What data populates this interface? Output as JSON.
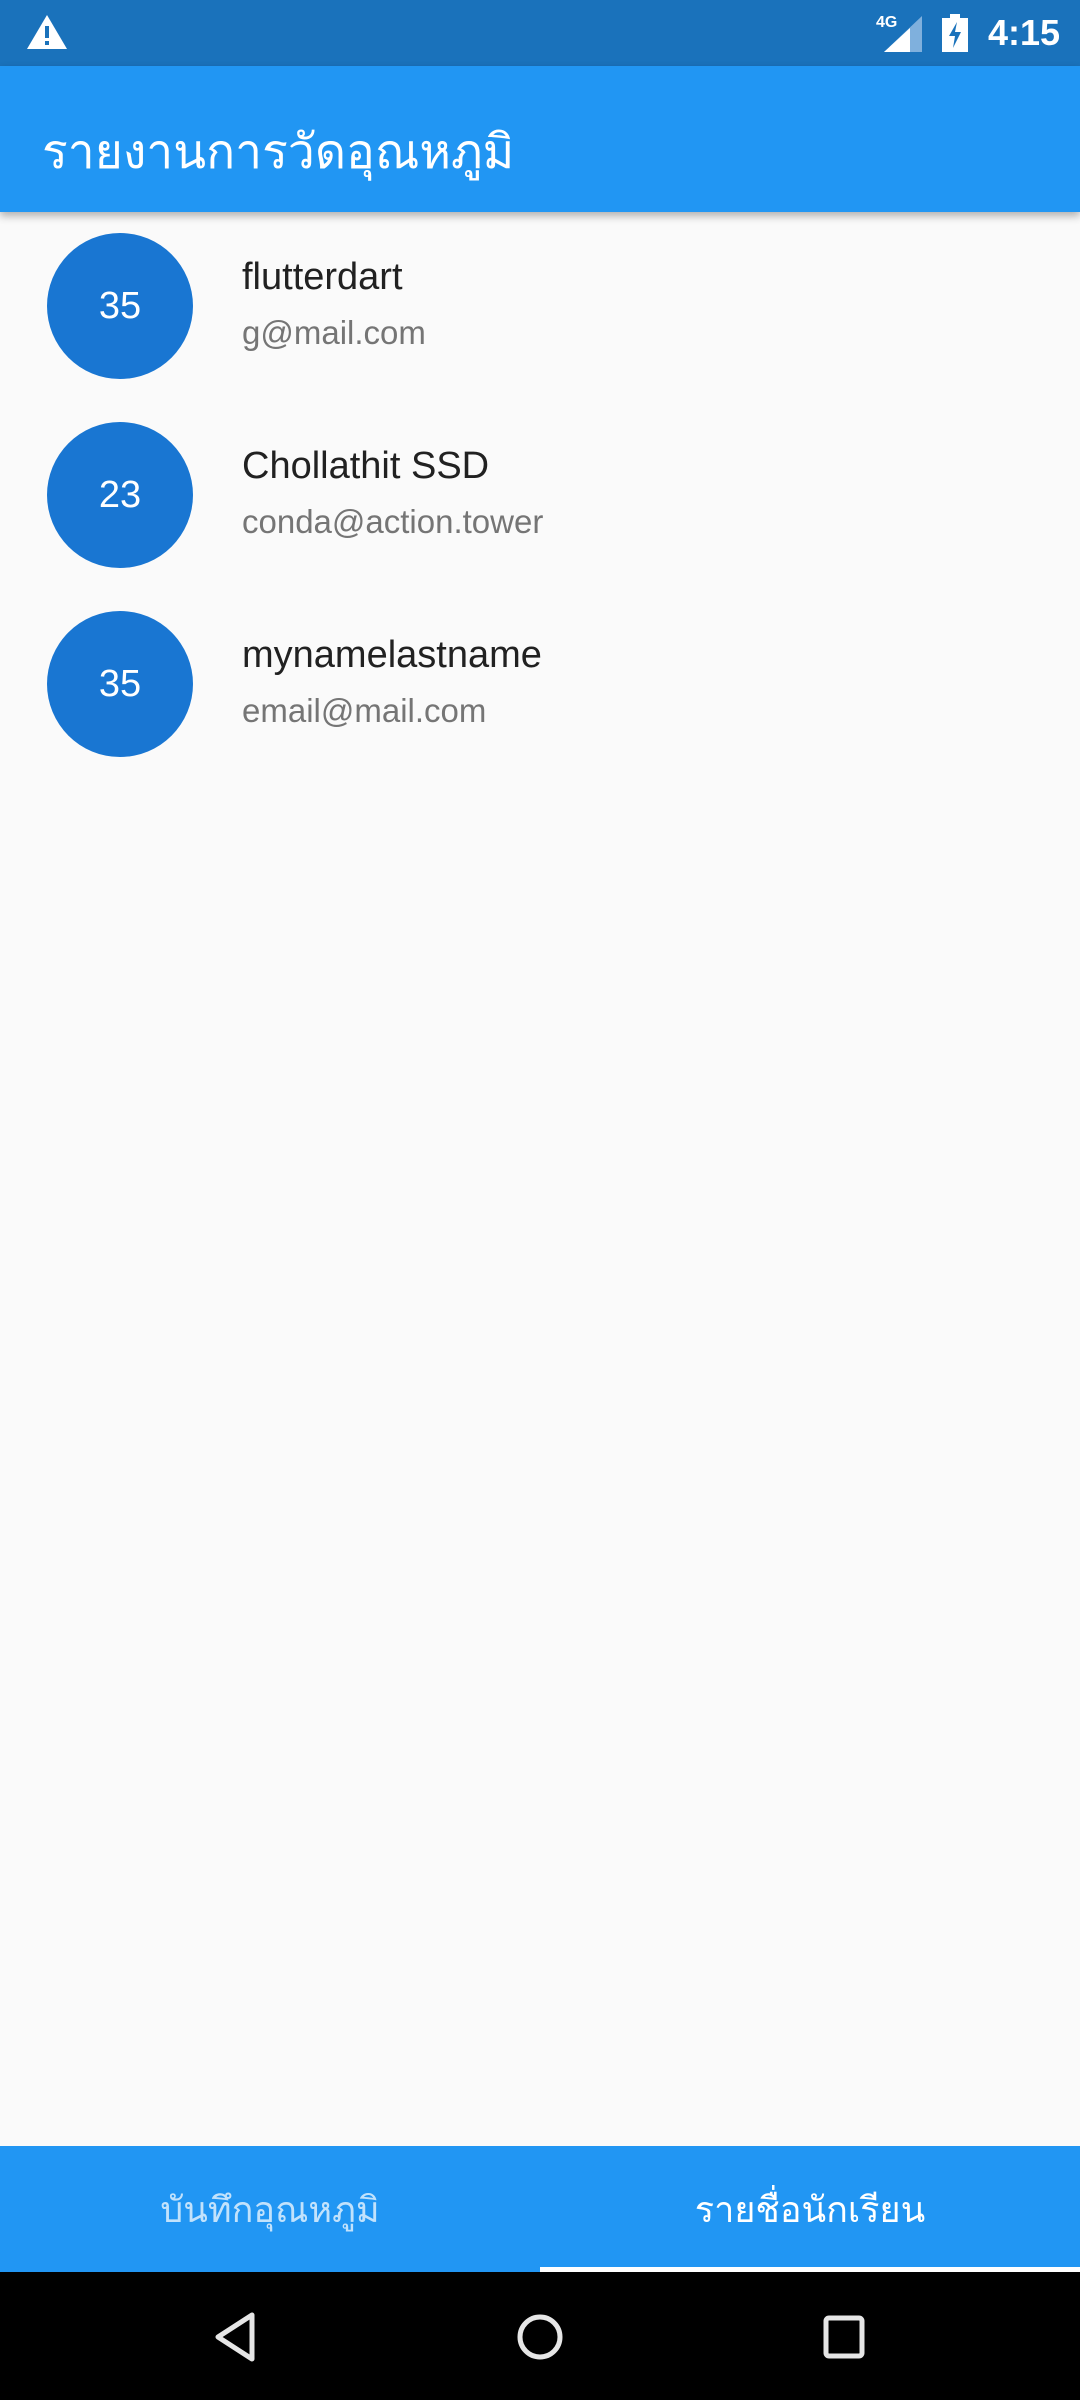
{
  "status_bar": {
    "time": "4:15",
    "network": "4G",
    "icons": [
      "warning-icon",
      "signal-icon",
      "battery-charging-icon"
    ]
  },
  "app_bar": {
    "title": "รายงานการวัดอุณหภูมิ"
  },
  "students": [
    {
      "value": "35",
      "name": "flutterdart",
      "email": "g@mail.com"
    },
    {
      "value": "23",
      "name": "Chollathit SSD",
      "email": "conda@action.tower"
    },
    {
      "value": "35",
      "name": "mynamelastname",
      "email": "email@mail.com"
    }
  ],
  "tabs": [
    {
      "label": "บันทึกอุณหภูมิ",
      "active": false
    },
    {
      "label": "รายชื่อนักเรียน",
      "active": true
    }
  ],
  "colors": {
    "primary": "#2196f3",
    "status_bar": "#1a72bb",
    "avatar": "#1976d2"
  },
  "nav_bar": {
    "icons": [
      "back-icon",
      "home-icon",
      "recents-icon"
    ]
  }
}
